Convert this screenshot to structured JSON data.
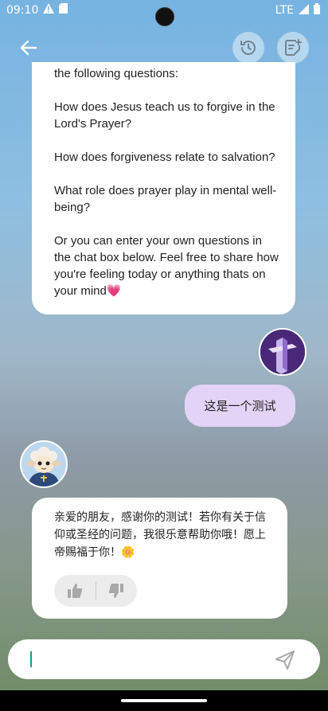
{
  "status_bar": {
    "time": "09:10",
    "network": "LTE",
    "icons_left": [
      "alert-icon",
      "sd-card-icon"
    ],
    "icons_right": [
      "signal-icon",
      "battery-icon"
    ]
  },
  "top_bar": {
    "back_icon": "arrow-left-icon",
    "history_icon": "history-icon",
    "new_chat_icon": "new-note-icon"
  },
  "messages": [
    {
      "sender": "bot",
      "text": "the following questions:\n\nHow does Jesus teach us to forgive in the Lord's Prayer?\n\nHow does forgiveness relate to salvation?\n\nWhat role does prayer play in mental well-being?\n\nOr you can enter your own questions in the chat box below. Feel free to share how you're feeling today or anything thats on your mind💗"
    },
    {
      "sender": "user",
      "text": "这是一个测试"
    },
    {
      "sender": "bot",
      "text": "亲爱的朋友，感谢你的测试！若你有关于信仰或圣经的问题，我很乐意帮助你哦！愿上帝赐福于你！🌼",
      "feedback": [
        "thumbs-up-icon",
        "thumbs-down-icon"
      ]
    }
  ],
  "input": {
    "value": "",
    "placeholder": "",
    "send_icon": "send-icon"
  },
  "colors": {
    "user_bubble": "#e3d3f7",
    "bot_bubble": "#ffffff",
    "cursor": "#1a9a8a"
  }
}
